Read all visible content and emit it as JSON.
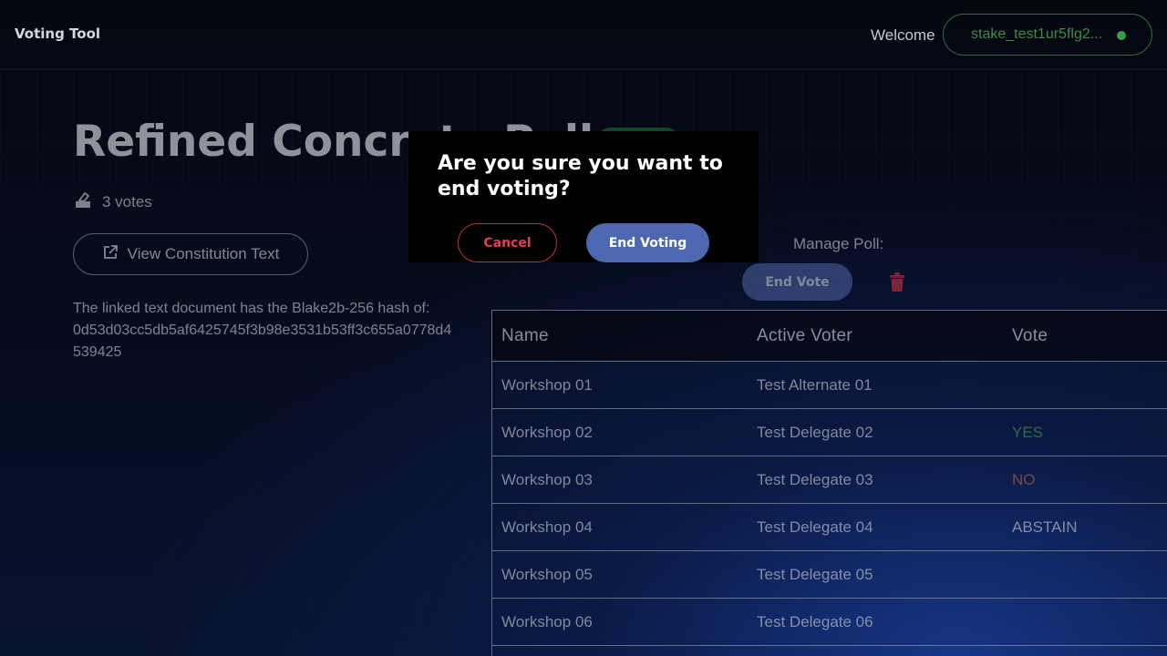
{
  "header": {
    "app_title": "Voting Tool",
    "welcome": "Welcome",
    "wallet_address": "stake_test1ur5flg2...",
    "wallet_status_color": "#3c9a48"
  },
  "poll": {
    "title": "Refined Concrete Poll",
    "status_color": "#1f6b33",
    "vote_count": "3 votes",
    "constitution_button": "View Constitution Text",
    "hash_lines": [
      "The linked text document has the Blake2b-256 hash of:",
      "0d53d03cc5db5af6425745f3b98e3531b53ff3c655a0778d4",
      "539425"
    ]
  },
  "manage": {
    "label": "Manage Poll:",
    "end_vote_button": "End Vote",
    "delete_icon": "trash-icon"
  },
  "table": {
    "headers": [
      "Name",
      "Active Voter",
      "Vote"
    ],
    "rows": [
      {
        "name": "Workshop 01",
        "voter": "Test Alternate 01",
        "vote": ""
      },
      {
        "name": "Workshop 02",
        "voter": "Test Delegate 02",
        "vote": "YES"
      },
      {
        "name": "Workshop 03",
        "voter": "Test Delegate 03",
        "vote": "NO"
      },
      {
        "name": "Workshop 04",
        "voter": "Test Delegate 04",
        "vote": "ABSTAIN"
      },
      {
        "name": "Workshop 05",
        "voter": "Test Delegate 05",
        "vote": ""
      },
      {
        "name": "Workshop 06",
        "voter": "Test Delegate 06",
        "vote": ""
      }
    ]
  },
  "modal": {
    "title": "Are you sure you want to end voting?",
    "cancel": "Cancel",
    "confirm": "End Voting"
  },
  "colors": {
    "yes": "#4f9a52",
    "no": "#c0623a",
    "accent": "#4d68b0",
    "danger": "#e0404e"
  }
}
